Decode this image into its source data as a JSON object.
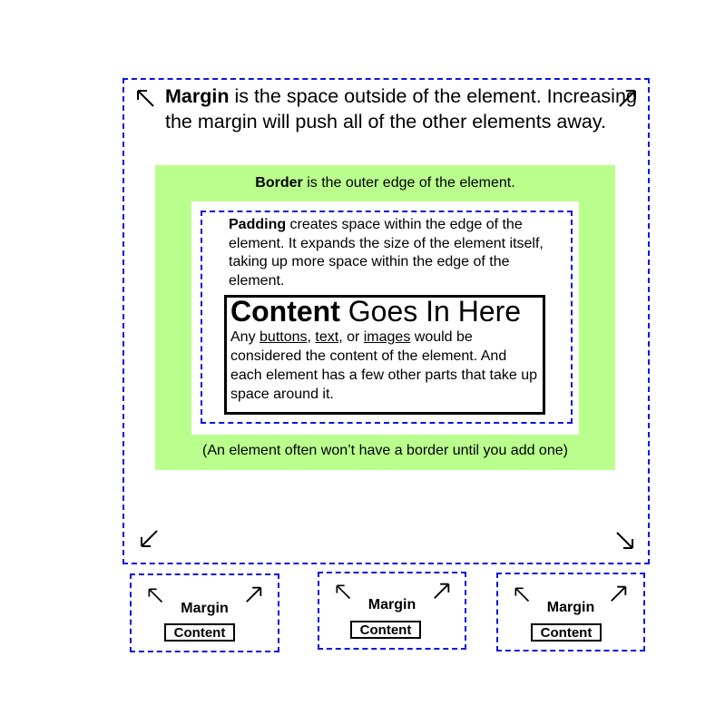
{
  "colors": {
    "margin_dash": "#0a14e6",
    "border_fill": "#baff8e",
    "padding_fill": "#ffffff",
    "content_border": "#000000"
  },
  "margin": {
    "term": "Margin",
    "text": " is the space outside of the element. Increasing the margin will push all of the other elements away.",
    "arrows": [
      "arrow-up-left-icon",
      "arrow-up-right-icon",
      "arrow-down-left-icon",
      "arrow-down-right-icon"
    ]
  },
  "border": {
    "term": "Border",
    "text": " is the outer edge of the element.",
    "note": "(An element often won’t have a border until you add one)"
  },
  "padding": {
    "term": "Padding",
    "text": " creates space within the edge of the element. It expands the size of the element itself, taking up more space within the edge of the element."
  },
  "content": {
    "term": "Content",
    "title_rest": " Goes In Here",
    "body_prefix": "Any ",
    "link1": "buttons",
    "sep1": ", ",
    "link2": "text",
    "sep2": ", or ",
    "link3": "images",
    "body_suffix": " would be considered the content of the element. And each element has a few other parts that take up space around it."
  },
  "mini_examples": [
    {
      "margin_label": "Margin",
      "content_label": "Content"
    },
    {
      "margin_label": "Margin",
      "content_label": "Content"
    },
    {
      "margin_label": "Margin",
      "content_label": "Content"
    }
  ]
}
